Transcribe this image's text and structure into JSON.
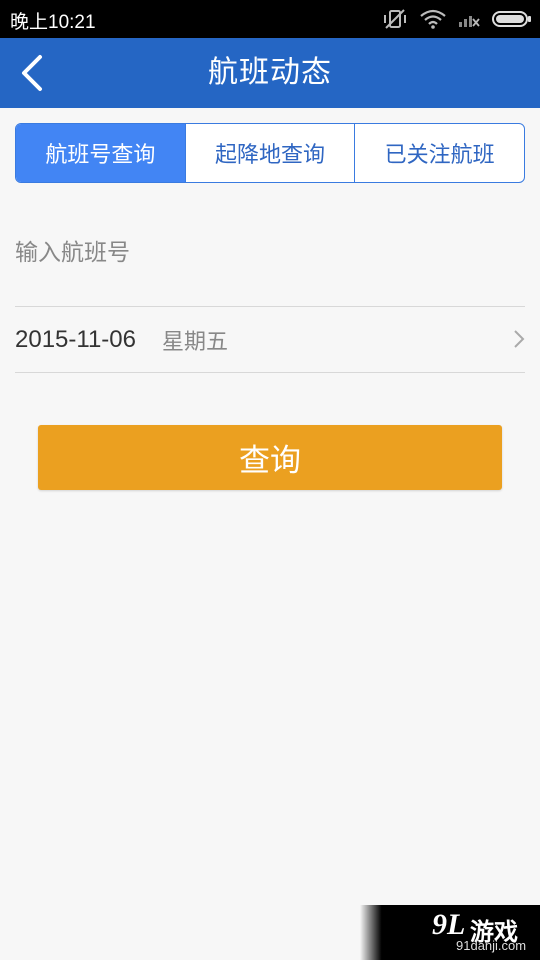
{
  "status_bar": {
    "time": "晚上10:21",
    "icons": [
      "mute-vibrate-icon",
      "wifi-icon",
      "signal-icon",
      "battery-icon"
    ]
  },
  "nav": {
    "title": "航班动态",
    "back_icon": "back-arrow-icon"
  },
  "tabs": [
    {
      "label": "航班号查询",
      "active": true
    },
    {
      "label": "起降地查询",
      "active": false
    },
    {
      "label": "已关注航班",
      "active": false
    }
  ],
  "flight_number": {
    "value": "",
    "placeholder": "输入航班号"
  },
  "date": {
    "value": "2015-11-06",
    "weekday": "星期五",
    "icon": "chevron-right-icon"
  },
  "query_button": {
    "label": "查询"
  },
  "watermark": {
    "logo": "9L",
    "title": "游戏",
    "url": "91danji.com"
  },
  "colors": {
    "nav_bar": "#2566c4",
    "tab_active": "#4285f4",
    "tab_border": "#3a7be0",
    "query_button": "#eba020",
    "background": "#f7f7f7"
  }
}
